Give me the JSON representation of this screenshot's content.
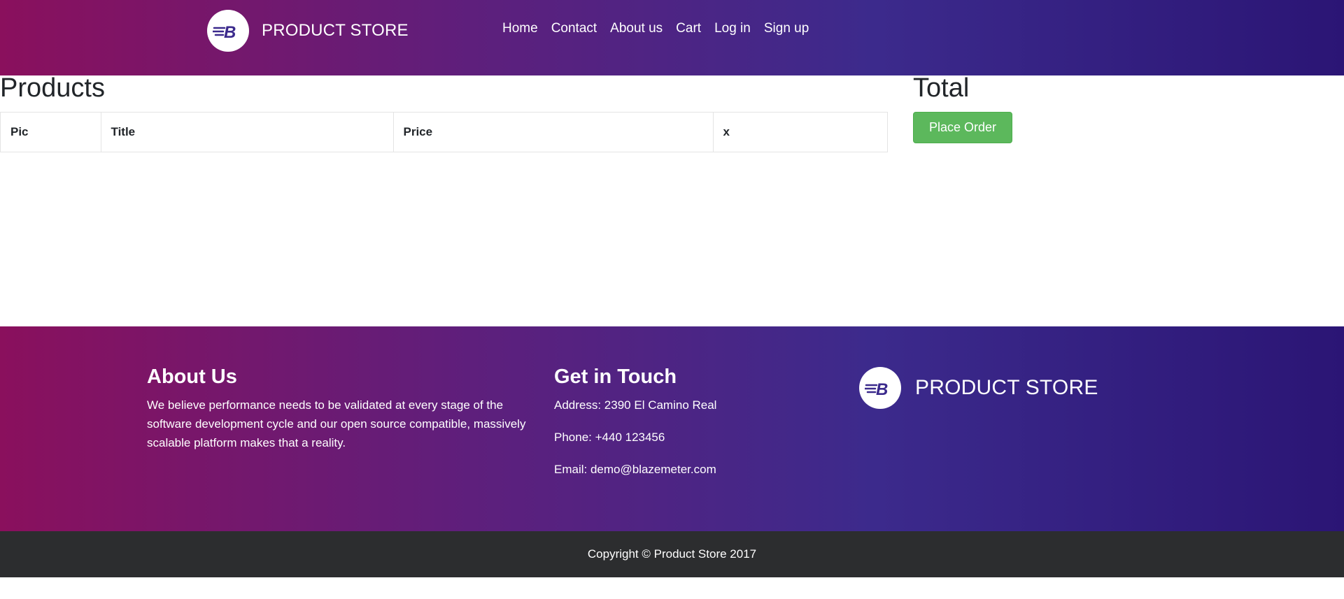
{
  "header": {
    "brand_name": "PRODUCT STORE",
    "logo_letter": "B",
    "nav": [
      {
        "label": "Home"
      },
      {
        "label": "Contact"
      },
      {
        "label": "About us"
      },
      {
        "label": "Cart"
      },
      {
        "label": "Log in"
      },
      {
        "label": "Sign up"
      }
    ]
  },
  "main": {
    "products_heading": "Products",
    "table_headers": [
      "Pic",
      "Title",
      "Price",
      "x"
    ],
    "total_heading": "Total",
    "place_order_label": "Place Order"
  },
  "footer": {
    "about": {
      "heading": "About Us",
      "text": "We believe performance needs to be validated at every stage of the software development cycle and our open source compatible, massively scalable platform makes that a reality."
    },
    "contact": {
      "heading": "Get in Touch",
      "address": "Address: 2390 El Camino Real",
      "phone": "Phone: +440 123456",
      "email": "Email: demo@blazemeter.com"
    },
    "brand_name": "PRODUCT STORE",
    "logo_letter": "B",
    "copyright": "Copyright © Product Store 2017"
  },
  "colors": {
    "gradient_start": "#8a105d",
    "gradient_end": "#2b1575",
    "logo_accent": "#3b2a8c",
    "place_order_bg": "#5cb85c",
    "copyright_bg": "#2c2d2f"
  }
}
